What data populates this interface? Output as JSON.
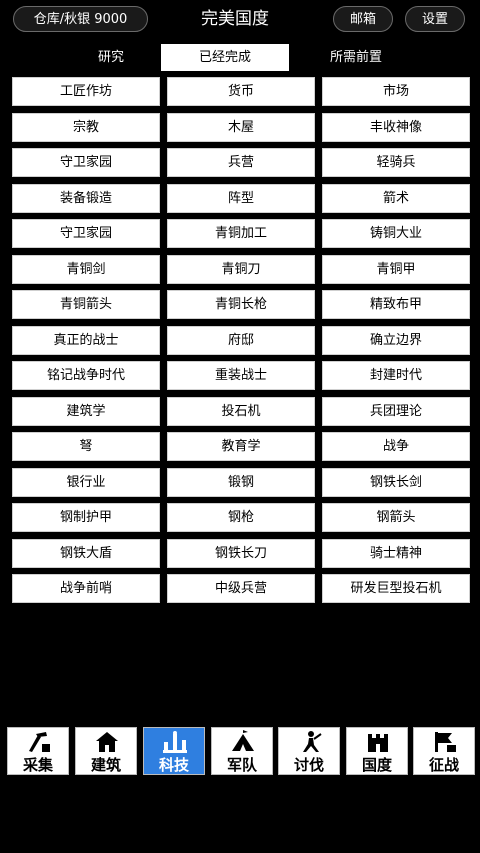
{
  "header": {
    "warehouse_label": "仓库/秋银 9000",
    "title": "完美国度",
    "mailbox_label": "邮箱",
    "settings_label": "设置"
  },
  "tabs": [
    {
      "label": "研究",
      "active": false
    },
    {
      "label": "已经完成",
      "active": true
    },
    {
      "label": "所需前置",
      "active": false
    }
  ],
  "tech_items": [
    "工匠作坊",
    "货币",
    "市场",
    "宗教",
    "木屋",
    "丰收神像",
    "守卫家园",
    "兵营",
    "轻骑兵",
    "装备锻造",
    "阵型",
    "箭术",
    "守卫家园",
    "青铜加工",
    "铸铜大业",
    "青铜剑",
    "青铜刀",
    "青铜甲",
    "青铜箭头",
    "青铜长枪",
    "精致布甲",
    "真正的战士",
    "府邸",
    "确立边界",
    "铭记战争时代",
    "重装战士",
    "封建时代",
    "建筑学",
    "投石机",
    "兵团理论",
    "弩",
    "教育学",
    "战争",
    "银行业",
    "锻钢",
    "钢铁长剑",
    "钢制护甲",
    "钢枪",
    "钢箭头",
    "钢铁大盾",
    "钢铁长刀",
    "骑士精神",
    "战争前哨",
    "中级兵营",
    "研发巨型投石机"
  ],
  "bottom_nav": [
    {
      "label": "采集",
      "icon": "gather-icon",
      "active": false
    },
    {
      "label": "建筑",
      "icon": "building-icon",
      "active": false
    },
    {
      "label": "科技",
      "icon": "tech-icon",
      "active": true
    },
    {
      "label": "军队",
      "icon": "army-icon",
      "active": false
    },
    {
      "label": "讨伐",
      "icon": "crusade-icon",
      "active": false
    },
    {
      "label": "国度",
      "icon": "kingdom-icon",
      "active": false
    },
    {
      "label": "征战",
      "icon": "campaign-icon",
      "active": false
    }
  ],
  "colors": {
    "background": "#000000",
    "accent_blue": "#2f7fe0",
    "cell_bg": "#ffffff"
  }
}
